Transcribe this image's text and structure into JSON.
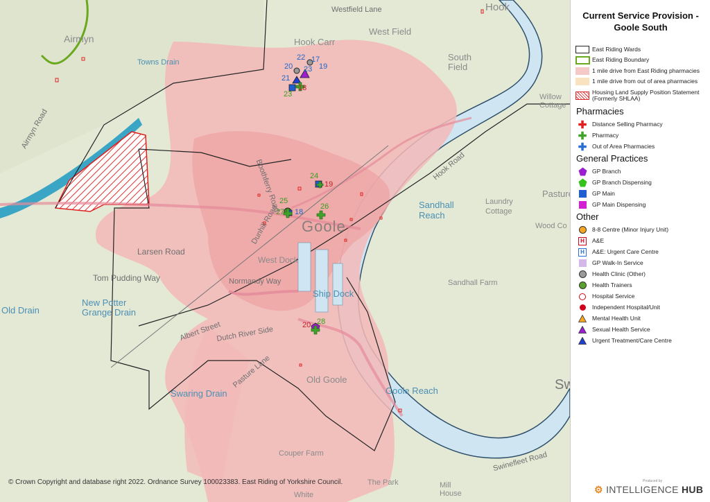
{
  "title": "Current Service Provision - Goole South",
  "place_labels": [
    "Hook",
    "Westfield Lane",
    "Airmyn",
    "West Field",
    "Hook Carr",
    "Towns Drain",
    "South Field",
    "Airmyn Road",
    "Willow Cottage",
    "Pasture",
    "Laundry Cottage",
    "Wood Co",
    "Sandhall Farm",
    "Larsen Road",
    "Tom Pudding Way",
    "Normandy Way",
    "New Potter Grange Drain",
    "Old Drain",
    "Albert Street",
    "Dutch River Side",
    "Pasture Lane",
    "Swaring Drain",
    "Couper Farm",
    "The Park",
    "Mill House",
    "White",
    "Swinefleet Road",
    "Hook Road",
    "Dunhill Road",
    "Boothferry Road",
    "Sw"
  ],
  "town_label": "Goole",
  "district_labels": [
    "Old Goole",
    "West Dock",
    "Ship Dock",
    "Sandhall Reach",
    "Goole Reach"
  ],
  "counts": {
    "hook_carr": {
      "a": "22",
      "b": "17",
      "c": "20",
      "d": "23",
      "e": "19",
      "f": "21",
      "g": "18",
      "h": "23"
    },
    "centre_north": {
      "a": "24",
      "b": "19"
    },
    "centre": {
      "a": "25",
      "b": "27",
      "c": "18",
      "d": "26"
    },
    "south": {
      "a": "20",
      "b": "28"
    }
  },
  "copyright": "© Crown Copyright and database right 2022. Ordnance Survey 100023383. East Riding of Yorkshire Council.",
  "legend": {
    "boundaries": [
      {
        "label": "East Riding Wards",
        "symbol": "box-outline"
      },
      {
        "label": "East Riding Boundary",
        "symbol": "box-green"
      },
      {
        "label": "1 mile drive from East Riding pharmacies",
        "symbol": "box-pink"
      },
      {
        "label": "1 mile drive from out of area pharmacies",
        "symbol": "box-peach"
      },
      {
        "label": "Housing Land Supply Position Statement (Formerly SHLAA)",
        "symbol": "box-hatch"
      }
    ],
    "pharmacies_heading": "Pharmacies",
    "pharmacies": [
      {
        "label": "Distance Selling Pharmacy",
        "color": "#e02020"
      },
      {
        "label": "Pharmacy",
        "color": "#3fa32a"
      },
      {
        "label": "Out of Area Pharmacies",
        "color": "#2a6fd1"
      }
    ],
    "gp_heading": "General Practices",
    "gp": [
      {
        "label": "GP Branch",
        "symbol": "pentagon",
        "color": "#9b1fd1"
      },
      {
        "label": "GP Branch Dispensing",
        "symbol": "pentagon",
        "color": "#35c21a"
      },
      {
        "label": "GP Main",
        "symbol": "square",
        "color": "#1f5fd1"
      },
      {
        "label": "GP Main Dispensing",
        "symbol": "square",
        "color": "#d11fd1"
      }
    ],
    "other_heading": "Other",
    "other": [
      {
        "label": "8-8 Centre (Minor Injury Unit)",
        "symbol": "circle",
        "color": "#f5a623"
      },
      {
        "label": "A&E",
        "symbol": "hsquare",
        "color": "#d0021b"
      },
      {
        "label": "A&E: Urgent Care Centre",
        "symbol": "hsquare",
        "color": "#2a6fd1"
      },
      {
        "label": "GP Walk-In Service",
        "symbol": "square-light",
        "color": "#d5b8ea"
      },
      {
        "label": "Health Clinic (Other)",
        "symbol": "circle",
        "color": "#9a9a9a"
      },
      {
        "label": "Health Trainers",
        "symbol": "circle",
        "color": "#5aa02c"
      },
      {
        "label": "Hospital Service",
        "symbol": "ring",
        "color": "#d0021b"
      },
      {
        "label": "Independent Hospital/Unit",
        "symbol": "circle",
        "color": "#d0021b"
      },
      {
        "label": "Mental Health Unit",
        "symbol": "triangle",
        "color": "#f5a623"
      },
      {
        "label": "Sexual Health Service",
        "symbol": "triangle",
        "color": "#9b1fd1"
      },
      {
        "label": "Urgent Treatment/Care Centre",
        "symbol": "triangle",
        "color": "#1f3fd1"
      }
    ]
  },
  "brand": {
    "produced_by": "Produced by",
    "name_a": "INTELLIGENCE",
    "name_b": "HUB"
  }
}
